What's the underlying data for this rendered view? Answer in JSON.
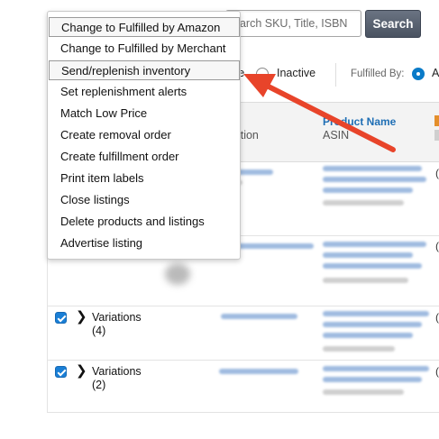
{
  "search": {
    "placeholder": "Search SKU, Title, ISBN",
    "visible_text": "earch SKU, Title, ISBN",
    "button_label": "Search"
  },
  "filters": {
    "active_fragment": "ve",
    "inactive_label": "Inactive",
    "fulfilled_by_label": "Fulfilled By:",
    "fulfilled_edge_fragment": "A"
  },
  "table": {
    "header": {
      "condition_fragment": "dition",
      "product_name": "Product Name",
      "asin": "ASIN"
    },
    "variation_rows": [
      {
        "label": "Variations",
        "count": "(4)"
      },
      {
        "label": "Variations",
        "count": "(2)"
      }
    ]
  },
  "menu": {
    "items": [
      {
        "label": "Change to Fulfilled by Amazon",
        "highlighted": true
      },
      {
        "label": "Change to Fulfilled by Merchant",
        "highlighted": false
      },
      {
        "label": "Send/replenish inventory",
        "highlighted": true
      },
      {
        "label": "Set replenishment alerts",
        "highlighted": false
      },
      {
        "label": "Match Low Price",
        "highlighted": false
      },
      {
        "label": "Create removal order",
        "highlighted": false
      },
      {
        "label": "Create fulfillment order",
        "highlighted": false
      },
      {
        "label": "Print item labels",
        "highlighted": false
      },
      {
        "label": "Close listings",
        "highlighted": false
      },
      {
        "label": "Delete products and listings",
        "highlighted": false
      },
      {
        "label": "Advertise listing",
        "highlighted": false
      }
    ]
  },
  "colors": {
    "annotation_arrow": "#e8442a",
    "link_blue": "#1f6fb5",
    "checkbox_blue": "#1a7fd6"
  }
}
